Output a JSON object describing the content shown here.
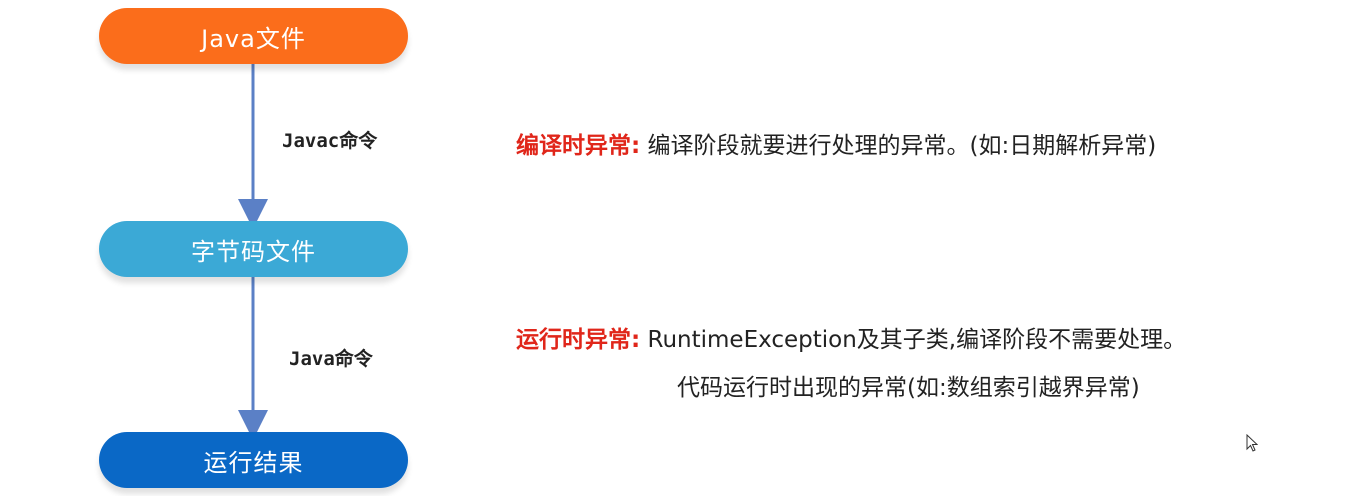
{
  "flow": {
    "nodes": [
      {
        "label": "Java文件",
        "color": "#fb6d1b"
      },
      {
        "label": "字节码文件",
        "color": "#3ba9d6"
      },
      {
        "label": "运行结果",
        "color": "#0a68c6"
      }
    ],
    "edges": [
      {
        "label": "Javac命令"
      },
      {
        "label": "Java命令"
      }
    ],
    "edge_color": "#5b80c6"
  },
  "descriptions": {
    "checked": {
      "term": "编译时异常:",
      "text": "编译阶段就要进行处理的异常。(如:日期解析异常)"
    },
    "runtime": {
      "term": "运行时异常:",
      "line1": "RuntimeException及其子类,编译阶段不需要处理。",
      "line2": "代码运行时出现的异常(如:数组索引越界异常)"
    },
    "term_color": "#e0261a"
  },
  "cursor": {
    "icon": "mouse-pointer-icon"
  }
}
